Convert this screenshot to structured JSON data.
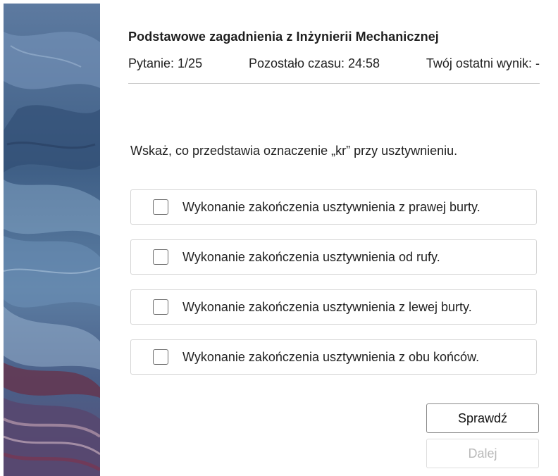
{
  "header": {
    "course_title": "Podstawowe zagadnienia z Inżynierii Mechanicznej",
    "question_counter": "Pytanie: 1/25",
    "time_left": "Pozostało czasu: 24:58",
    "last_score": "Twój ostatni wynik: -"
  },
  "question": {
    "text": "Wskaż, co przedstawia oznaczenie „kr” przy usztywnieniu."
  },
  "answers": [
    {
      "label": "Wykonanie zakończenia usztywnienia z prawej burty.",
      "checked": false
    },
    {
      "label": "Wykonanie zakończenia usztywnienia od rufy.",
      "checked": false
    },
    {
      "label": "Wykonanie zakończenia usztywnienia z lewej burty.",
      "checked": false
    },
    {
      "label": "Wykonanie zakończenia usztywnienia z obu końców.",
      "checked": false
    }
  ],
  "buttons": {
    "check_label": "Sprawdź",
    "next_label": "Dalej",
    "next_enabled": false
  },
  "colors": {
    "divider": "#c9c9c9",
    "border": "#d6d6d6",
    "disabled_text": "#b9b9b9"
  }
}
